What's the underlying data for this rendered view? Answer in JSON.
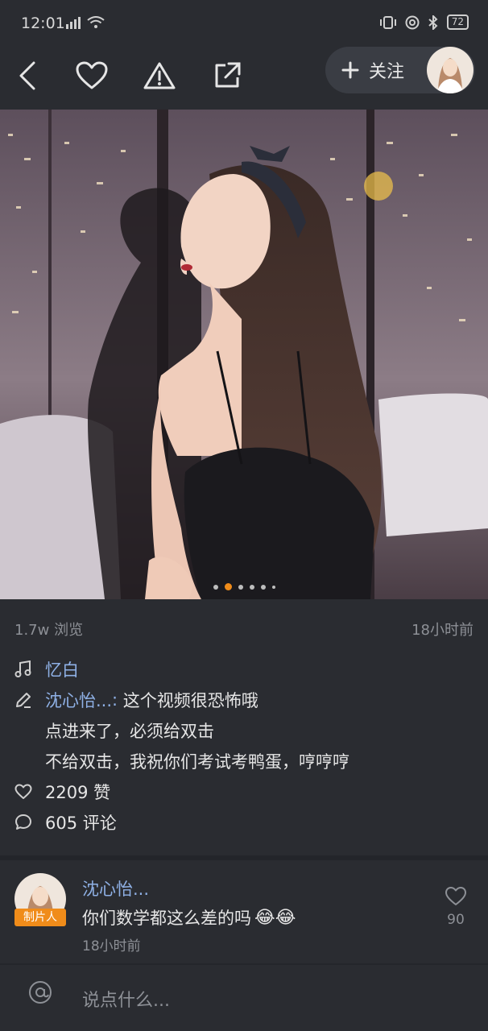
{
  "status": {
    "time": "12:01",
    "battery": "72"
  },
  "topbar": {
    "follow_label": "关注"
  },
  "photo": {
    "dots_total": 6,
    "active_dot": 1
  },
  "meta": {
    "views": "1.7w 浏览",
    "posted": "18小时前"
  },
  "post": {
    "music": "忆白",
    "author": "沈心怡...",
    "author_sep": ":",
    "caption_line1": " 这个视频很恐怖哦",
    "caption_line2": "点进来了，必须给双击",
    "caption_line3": "不给双击，我祝你们考试考鸭蛋，哼哼哼",
    "likes": "2209 赞",
    "comments": "605 评论"
  },
  "comment": {
    "name": "沈心怡...",
    "badge": "制片人",
    "text": "你们数学都这么差的吗",
    "emoji": "😂😂",
    "time": "18小时前",
    "likes": "90"
  },
  "input": {
    "placeholder": "说点什么..."
  }
}
